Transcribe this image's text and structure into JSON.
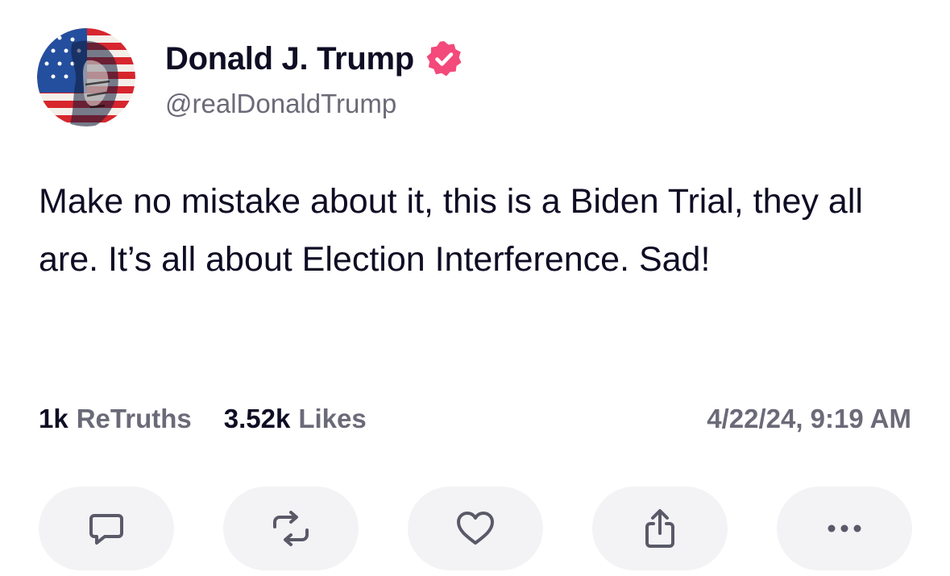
{
  "author": {
    "display_name": "Donald J. Trump",
    "handle": "@realDonaldTrump",
    "verified": true,
    "verified_color": "#f3497b",
    "avatar_icon": "flag-portrait-avatar"
  },
  "post": {
    "text": "Make no mistake about it, this is a Biden Trial, they all are. It’s all about Election Interference. Sad!"
  },
  "stats": {
    "retruths_count": "1k",
    "retruths_label": "ReTruths",
    "likes_count": "3.52k",
    "likes_label": "Likes",
    "timestamp": "4/22/24, 9:19 AM"
  },
  "actions": [
    {
      "icon": "reply-icon"
    },
    {
      "icon": "retruth-icon"
    },
    {
      "icon": "heart-icon"
    },
    {
      "icon": "share-icon"
    },
    {
      "icon": "more-icon"
    }
  ],
  "colors": {
    "text_primary": "#0f0d24",
    "text_secondary": "#6b6a78",
    "button_bg": "#f3f3f6",
    "icon_stroke": "#5a5968"
  }
}
